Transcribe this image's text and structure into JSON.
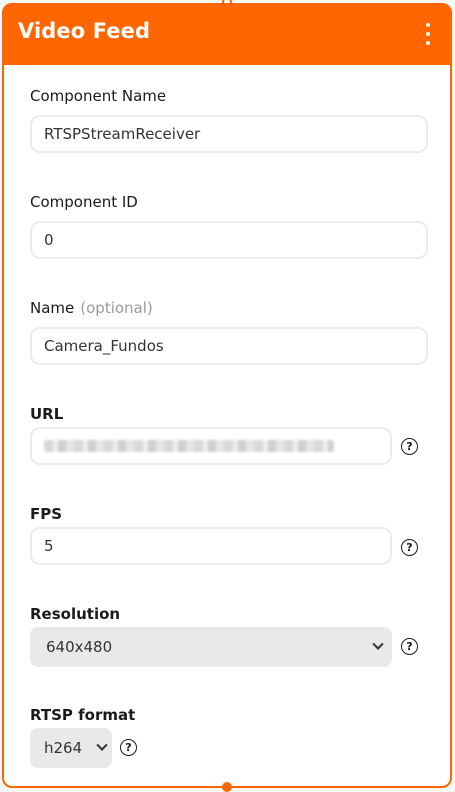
{
  "node": {
    "title": "Video Feed"
  },
  "fields": {
    "component_name": {
      "label": "Component Name",
      "value": "RTSPStreamReceiver"
    },
    "component_id": {
      "label": "Component ID",
      "value": "0"
    },
    "name": {
      "label": "Name",
      "optional_tag": "(optional)",
      "value": "Camera_Fundos"
    },
    "url": {
      "label": "URL",
      "help": "?"
    },
    "fps": {
      "label": "FPS",
      "value": "5",
      "help": "?"
    },
    "resolution": {
      "label": "Resolution",
      "selected": "640x480",
      "help": "?"
    },
    "rtsp_format": {
      "label": "RTSP format",
      "selected": "h264",
      "help": "?"
    }
  },
  "colors": {
    "accent": "#ff6600",
    "field_border": "#ececec",
    "select_bg": "#e9e9e9"
  },
  "icons": {
    "menu": "kebab-menu-icon",
    "help": "question-circle-icon",
    "dropdown": "chevron-down-icon"
  }
}
